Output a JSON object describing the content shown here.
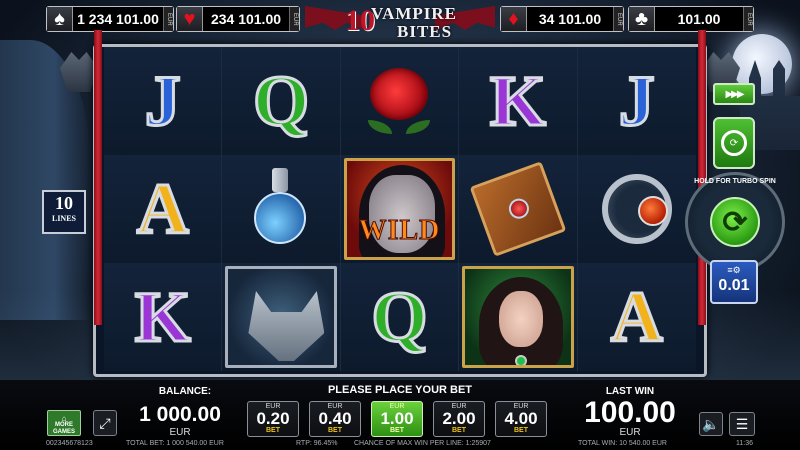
{
  "top_bar": {
    "jackpots": [
      {
        "suit": "spade",
        "glyph": "♠",
        "value": "1 234 101.00",
        "currency": "EUR",
        "color": "#ffffff"
      },
      {
        "suit": "heart",
        "glyph": "♥",
        "value": "234 101.00",
        "currency": "EUR",
        "color": "#e0121e"
      },
      {
        "suit": "diamond",
        "glyph": "♦",
        "value": "34 101.00",
        "currency": "EUR",
        "color": "#e0121e"
      },
      {
        "suit": "club",
        "glyph": "♣",
        "value": "101.00",
        "currency": "EUR",
        "color": "#ffffff"
      }
    ],
    "logo": {
      "number": "10",
      "line1": "VAMPIRE",
      "line2": "BITES"
    }
  },
  "reels": {
    "grid": [
      [
        "J",
        "Q",
        "rose",
        "K",
        "J"
      ],
      [
        "A",
        "potion",
        "WILD",
        "book",
        "amulet"
      ],
      [
        "K",
        "wolf",
        "Q",
        "lady",
        "A"
      ]
    ],
    "wild_label": "WILD"
  },
  "lines_badge": {
    "number": "10",
    "label": "LINES"
  },
  "controls": {
    "autoplay_glyph": "▶▶▶",
    "spin_hint_top": "HOLD FOR TURBO SPIN",
    "spin_glyph": "⟳",
    "gamble_glyph": "⟳",
    "coin_icon": "≡⚙",
    "coin_value": "0.01"
  },
  "bottom": {
    "balance_label": "BALANCE:",
    "balance_value": "1 000.00",
    "balance_currency": "EUR",
    "prompt": "PLEASE PLACE YOUR BET",
    "last_win_label": "LAST WIN",
    "last_win_value": "100.00",
    "last_win_currency": "EUR",
    "more_games_line1": "MORE",
    "more_games_line2": "GAMES",
    "fullscreen_glyph": "⤢",
    "sound_glyph": "🔈",
    "menu_glyph": "☰",
    "bets": [
      {
        "currency": "EUR",
        "value": "0.20",
        "label": "BET",
        "selected": false
      },
      {
        "currency": "EUR",
        "value": "0.40",
        "label": "BET",
        "selected": false
      },
      {
        "currency": "EUR",
        "value": "1.00",
        "label": "BET",
        "selected": true
      },
      {
        "currency": "EUR",
        "value": "2.00",
        "label": "BET",
        "selected": false
      },
      {
        "currency": "EUR",
        "value": "4.00",
        "label": "BET",
        "selected": false
      }
    ]
  },
  "status_bar": {
    "session_id": "002345678123",
    "total_bet": "TOTAL BET: 1 000 540.00 EUR",
    "rtp": "RTP: 96.45%",
    "chance": "CHANCE OF MAX WIN PER LINE: 1:25907",
    "total_win": "TOTAL WIN: 10 540.00 EUR",
    "clock": "11:36"
  },
  "colors": {
    "frame": "#b7bcc4",
    "accent_green": "#2e8f12",
    "accent_red": "#c01428",
    "coin_blue": "#2b5cc0"
  }
}
